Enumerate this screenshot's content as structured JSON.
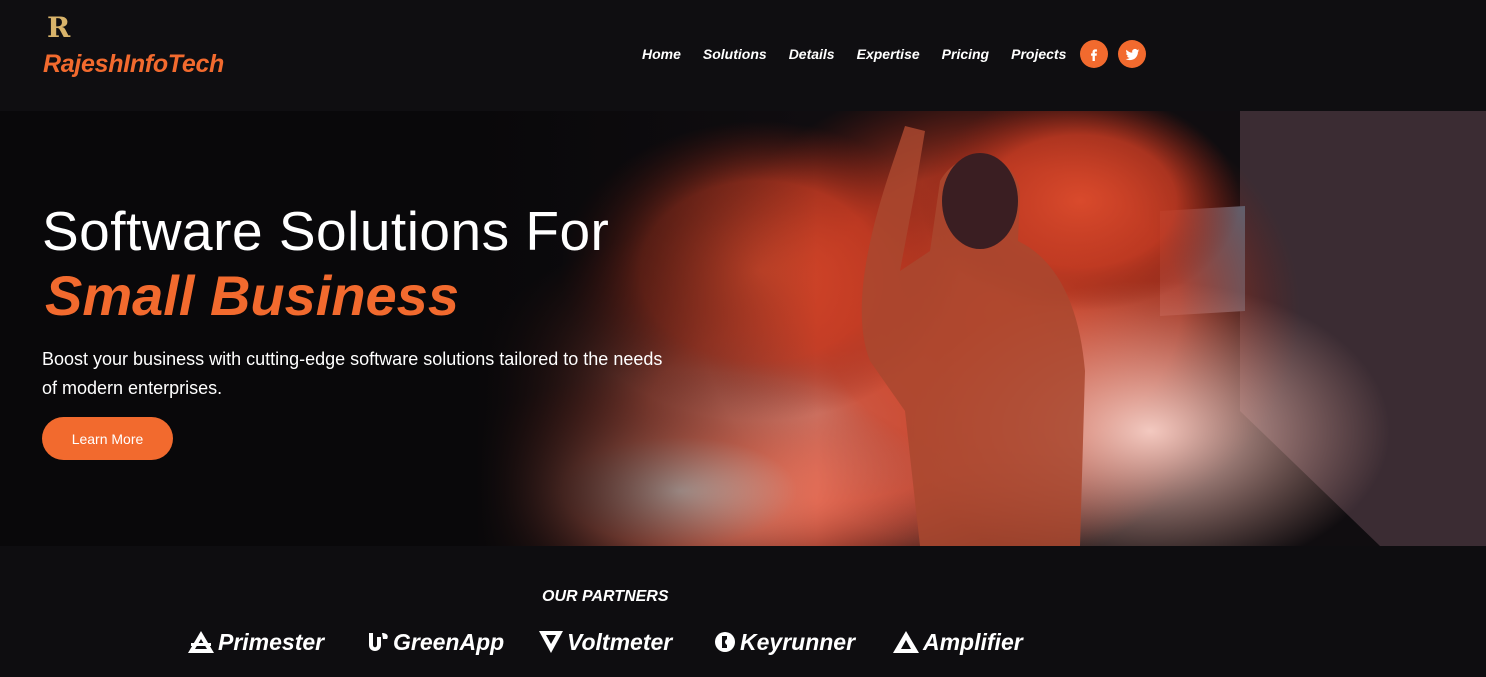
{
  "brand": {
    "mark": "R",
    "name": "RajeshInfoTech"
  },
  "nav": {
    "items": [
      {
        "label": "Home"
      },
      {
        "label": "Solutions"
      },
      {
        "label": "Details"
      },
      {
        "label": "Expertise"
      },
      {
        "label": "Pricing"
      },
      {
        "label": "Projects"
      }
    ],
    "social": [
      {
        "icon": "facebook-icon"
      },
      {
        "icon": "twitter-icon"
      }
    ]
  },
  "hero": {
    "title": "Software Solutions For",
    "accent": "Small Business",
    "description": "Boost your business with cutting-edge software solutions tailored to the needs of modern enterprises.",
    "cta": "Learn More"
  },
  "partners": {
    "heading": "OUR PARTNERS",
    "items": [
      {
        "name": "Primester",
        "icon": "primester-logo-icon"
      },
      {
        "name": "GreenApp",
        "icon": "greenapp-logo-icon"
      },
      {
        "name": "Voltmeter",
        "icon": "voltmeter-logo-icon"
      },
      {
        "name": "Keyrunner",
        "icon": "keyrunner-logo-icon"
      },
      {
        "name": "Amplifier",
        "icon": "amplifier-logo-icon"
      }
    ]
  },
  "colors": {
    "accent": "#f26a2e",
    "background": "#0e0d10",
    "logo_gold": "#d8b36a"
  }
}
